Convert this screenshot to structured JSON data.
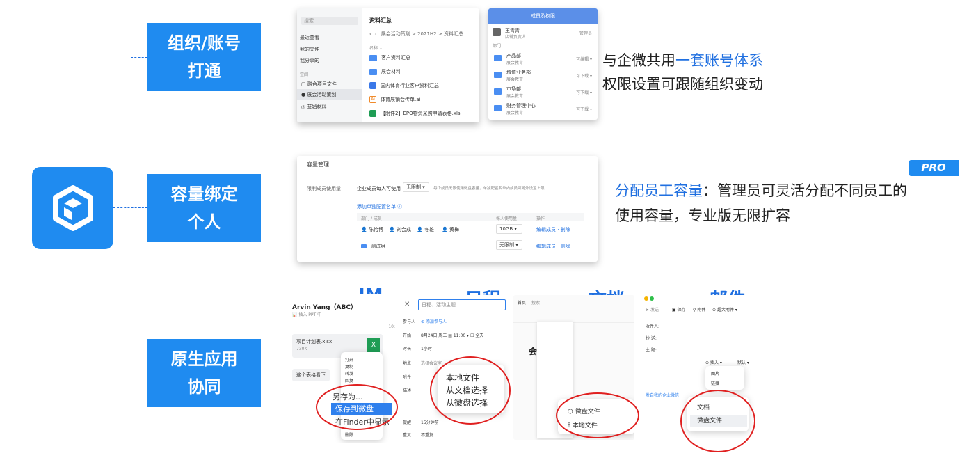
{
  "features": [
    {
      "line1": "组织/账号",
      "line2": "打通"
    },
    {
      "line1": "容量绑定",
      "line2": "个人"
    },
    {
      "line1": "原生应用",
      "line2": "协同"
    }
  ],
  "file_panel": {
    "search": "搜索",
    "nav": [
      "最近查看",
      "我的文件",
      "我分享的"
    ],
    "space_label": "空间",
    "spaces": [
      "融合项目文件",
      "展会活动策划",
      "营销材料"
    ],
    "title": "资料汇总",
    "breadcrumb": [
      "展会活动策划",
      "2021H2",
      "资料汇总"
    ],
    "col_name": "名称 ⇣",
    "files": [
      "客户资料汇总",
      "展会材料",
      "国内体育行业客户资料汇总",
      "体育展销会传单.ai",
      "【附件2】EPO物资采购申请表格.xls"
    ]
  },
  "member_panel": {
    "title": "成员及权限",
    "owner": {
      "name": "王青青",
      "role": "店铺负责人",
      "perm": "管理员"
    },
    "dept_label": "部门",
    "depts": [
      {
        "name": "产品部",
        "sub": "展会教育",
        "perm": "可编辑 ▾"
      },
      {
        "name": "增值业务部",
        "sub": "展会教育",
        "perm": "可下载 ▾"
      },
      {
        "name": "市场部",
        "sub": "展会教育",
        "perm": "可下载 ▾"
      },
      {
        "name": "财务管理中心",
        "sub": "展会教育",
        "perm": "可下载 ▾"
      }
    ]
  },
  "desc1": {
    "pre": "与企微共用",
    "hl": "一套账号体系",
    "line2": "权限设置可跟随组织变动"
  },
  "capacity": {
    "title": "容量管理",
    "row_label": "限制成员使用量",
    "per_label": "企业成员每人可使用",
    "select": "无限制 ▾",
    "hint": "每个成员无限使用微盘容量，单独配置名单内成员可另外设置上限",
    "add_link": "添加单独配置名单 ⓘ",
    "headers": [
      "部门 / 成员",
      "每人使用量",
      "操作"
    ],
    "rows": [
      {
        "members": [
          "陈怡博",
          "刘会成",
          "冬雄",
          "黄梅"
        ],
        "limit": "10GB ▾",
        "ops": "编辑成员 · 删除"
      },
      {
        "members": [
          "测试组"
        ],
        "limit": "无限制 ▾",
        "ops": "编辑成员 · 删除"
      }
    ]
  },
  "pro_badge": "PRO",
  "desc2": {
    "hl": "分配员工容量",
    "rest": "：管理员可灵活分配不同员工的",
    "line2": "使用容量，专业版无限扩容"
  },
  "app_labels": [
    "IM",
    "日程",
    "文档",
    "邮件"
  ],
  "im": {
    "name": "Arvin Yang（ABC）",
    "status": "📊 插入 PPT 中",
    "time": "10:",
    "file_name": "项目计划表.xlsx",
    "file_size": "730K",
    "file_icon": "X",
    "msg": "这个表格看下",
    "menu_small": [
      "打开",
      "复制",
      "转发",
      "回复"
    ],
    "menu": [
      "另存为...",
      "保存到微盘",
      "在Finder中显示"
    ],
    "menu_tail": "删除"
  },
  "schedule": {
    "close": "✕",
    "title_ph": "日程、活动主题",
    "fields": [
      {
        "label": "参与人",
        "value": "⊕ 添加参与人"
      },
      {
        "label": "开始",
        "value": "8月24日 周三   ▤     11:00 ▾   ☐ 全天"
      },
      {
        "label": "时长",
        "value": "1小时"
      },
      {
        "label": "地点",
        "value": "选择会议室"
      },
      {
        "label": "附件",
        "value": ""
      },
      {
        "label": "描述",
        "value": ""
      },
      {
        "label": "提醒",
        "value": "15分钟前"
      },
      {
        "label": "重复",
        "value": "不重复"
      }
    ],
    "menu": [
      "本地文件",
      "从文档选择",
      "从微盘选择"
    ]
  },
  "doc": {
    "top": [
      "首页",
      "搜索"
    ],
    "heading": "会",
    "menu": [
      "微盘文件",
      "本地文件"
    ]
  },
  "mail": {
    "toolbar": [
      "发送",
      "保存",
      "附件",
      "超大附件 ▾"
    ],
    "fields": [
      "收件人:",
      "抄  送:",
      "主  题:"
    ],
    "insert": "⊕ 插入 ▾",
    "default": "默认 ▾",
    "insert_items": [
      "图片",
      "链接"
    ],
    "link": "发自我的企业微信",
    "menu": [
      "文档",
      "微盘文件"
    ]
  },
  "colors": {
    "accent": "#1f8bf0",
    "highlight": "#1f6fe0",
    "circle": "#e02020"
  }
}
